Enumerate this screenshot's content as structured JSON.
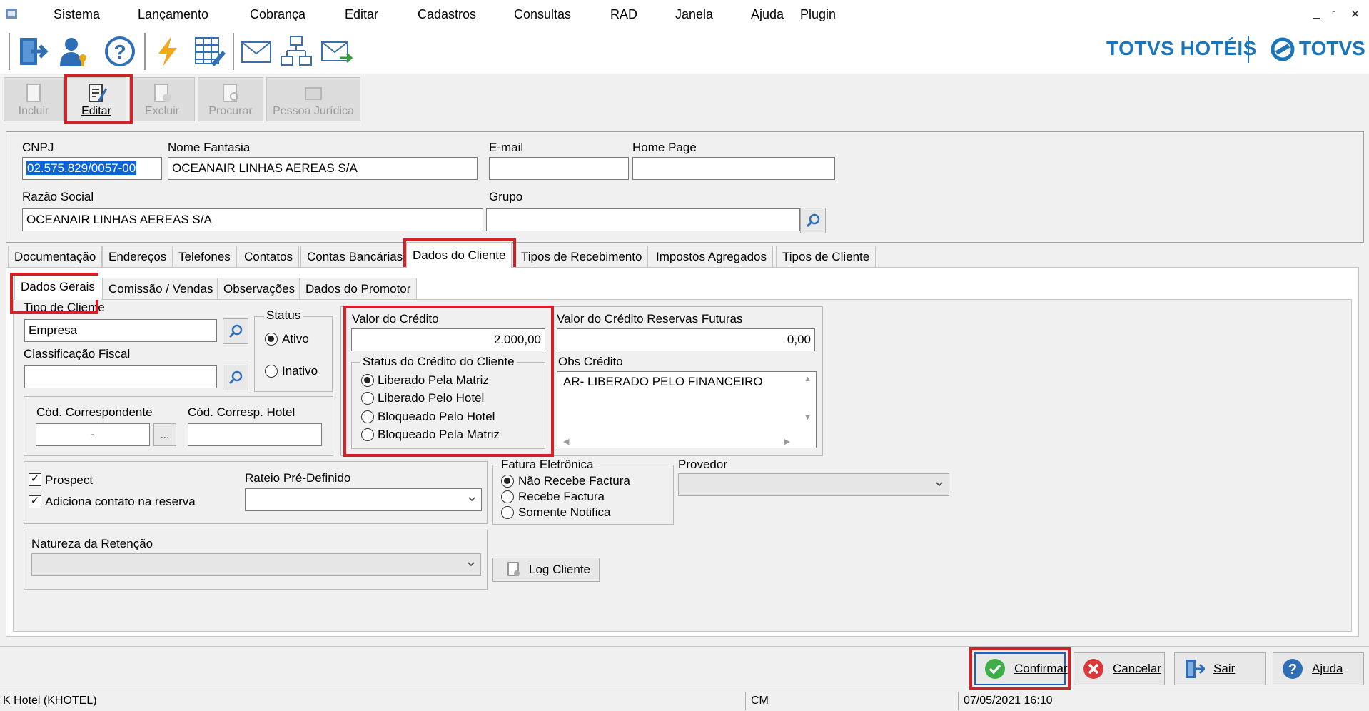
{
  "menu": [
    "Sistema",
    "Lançamento",
    "Cobrança",
    "Editar",
    "Cadastros",
    "Consultas",
    "RAD",
    "Janela",
    "Ajuda",
    "Plugin"
  ],
  "brand": {
    "left": "TOTVS HOTÉIS",
    "right": "TOTVS",
    "color": "#1b75bb"
  },
  "actions": {
    "incluir": "Incluir",
    "editar": "Editar",
    "excluir": "Excluir",
    "procurar": "Procurar",
    "pessoa_juridica": "Pessoa Jurídica"
  },
  "header": {
    "cnpj_label": "CNPJ",
    "cnpj_value": "02.575.829/0057-00",
    "nome_fantasia_label": "Nome Fantasia",
    "nome_fantasia_value": "OCEANAIR LINHAS AEREAS S/A",
    "email_label": "E-mail",
    "email_value": "",
    "home_page_label": "Home Page",
    "home_page_value": "",
    "razao_social_label": "Razão Social",
    "razao_social_value": "OCEANAIR LINHAS AEREAS S/A",
    "grupo_label": "Grupo",
    "grupo_value": ""
  },
  "tabs": [
    "Documentação",
    "Endereços",
    "Telefones",
    "Contatos",
    "Contas Bancárias",
    "Dados do Cliente",
    "Tipos de Recebimento",
    "Impostos Agregados",
    "Tipos de Cliente"
  ],
  "active_tab": "Dados do Cliente",
  "subtabs": [
    "Dados Gerais",
    "Comissão / Vendas",
    "Observações",
    "Dados do Promotor"
  ],
  "active_subtab": "Dados Gerais",
  "dados_gerais": {
    "tipo_cliente_label": "Tipo de Cliente",
    "tipo_cliente_value": "Empresa",
    "classificacao_fiscal_label": "Classificação Fiscal",
    "classificacao_fiscal_value": "",
    "status_label": "Status",
    "status_options": [
      "Ativo",
      "Inativo"
    ],
    "status_selected": "Ativo",
    "cod_correspondente_label": "Cód. Correspondente",
    "cod_correspondente_value": "-",
    "ellipsis": "...",
    "cod_corresp_hotel_label": "Cód. Corresp. Hotel",
    "cod_corresp_hotel_value": "",
    "valor_credito_label": "Valor do Crédito",
    "valor_credito_value": "2.000,00",
    "status_credito_label": "Status do Crédito do Cliente",
    "status_credito_options": [
      "Liberado Pela Matriz",
      "Liberado Pelo Hotel",
      "Bloqueado Pelo Hotel",
      "Bloqueado Pela Matriz"
    ],
    "status_credito_selected": "Liberado Pela Matriz",
    "valor_credito_futuras_label": "Valor do Crédito Reservas Futuras",
    "valor_credito_futuras_value": "0,00",
    "obs_credito_label": "Obs Crédito",
    "obs_credito_value": "AR- LIBERADO PELO FINANCEIRO",
    "prospect_label": "Prospect",
    "prospect_checked": true,
    "adiciona_contato_label": "Adiciona contato na reserva",
    "adiciona_contato_checked": true,
    "rateio_label": "Rateio Pré-Definido",
    "rateio_value": "",
    "fatura_label": "Fatura Eletrônica",
    "fatura_options": [
      "Não Recebe Factura",
      "Recebe Factura",
      "Somente Notifica"
    ],
    "fatura_selected": "Não Recebe Factura",
    "provedor_label": "Provedor",
    "provedor_value": "",
    "natureza_label": "Natureza da Retenção",
    "natureza_value": "",
    "log_cliente_label": "Log Cliente"
  },
  "bottom_buttons": {
    "confirmar": "Confirmar",
    "cancelar": "Cancelar",
    "sair": "Sair",
    "ajuda": "Ajuda"
  },
  "status_bar": {
    "hotel": "K Hotel (KHOTEL)",
    "code": "CM",
    "datetime": "07/05/2021 16:10"
  },
  "highlight_color": "#d42127"
}
